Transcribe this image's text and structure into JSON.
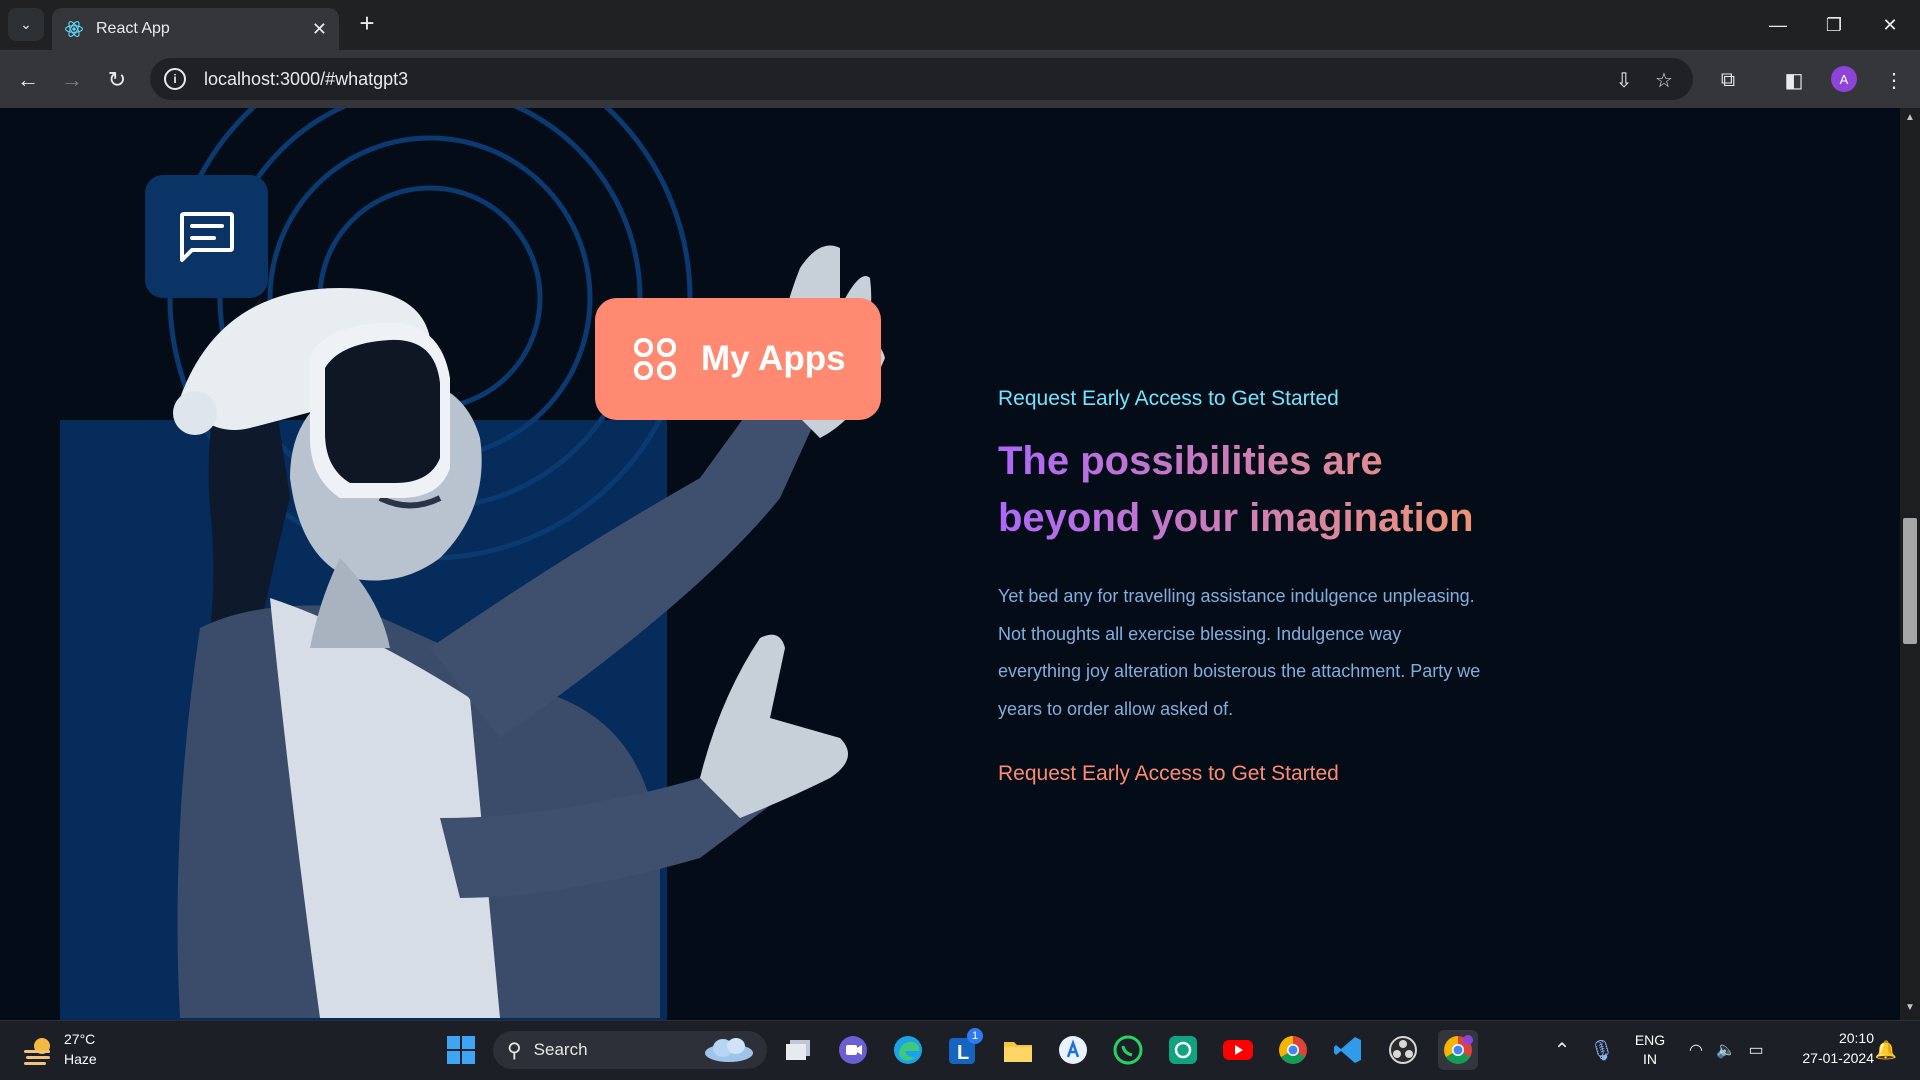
{
  "browser": {
    "tab_title": "React App",
    "url": "localhost:3000/#whatgpt3",
    "avatar_letter": "A"
  },
  "hero": {
    "apps_label": "My Apps",
    "subtitle": "Request Early Access to Get Started",
    "heading": "The possibilities are beyond your imagination",
    "body": "Yet bed any for travelling assistance indulgence unpleasing. Not thoughts all exercise blessing. Indulgence way everything joy alteration boisterous the attachment. Party we years to order allow asked of.",
    "cta": "Request Early Access to Get Started"
  },
  "taskbar": {
    "weather_temp": "27°C",
    "weather_desc": "Haze",
    "search_label": "Search",
    "notification_badge": "1",
    "lang_top": "ENG",
    "lang_bottom": "IN",
    "time": "20:10",
    "date": "27-01-2024"
  },
  "colors": {
    "page_bg": "#040c18",
    "accent_orange": "#ff8a71",
    "accent_cyan": "#71e5ff",
    "gradient_start": "#ae67fa",
    "gradient_end": "#f49867",
    "body_text": "#81afdd"
  }
}
